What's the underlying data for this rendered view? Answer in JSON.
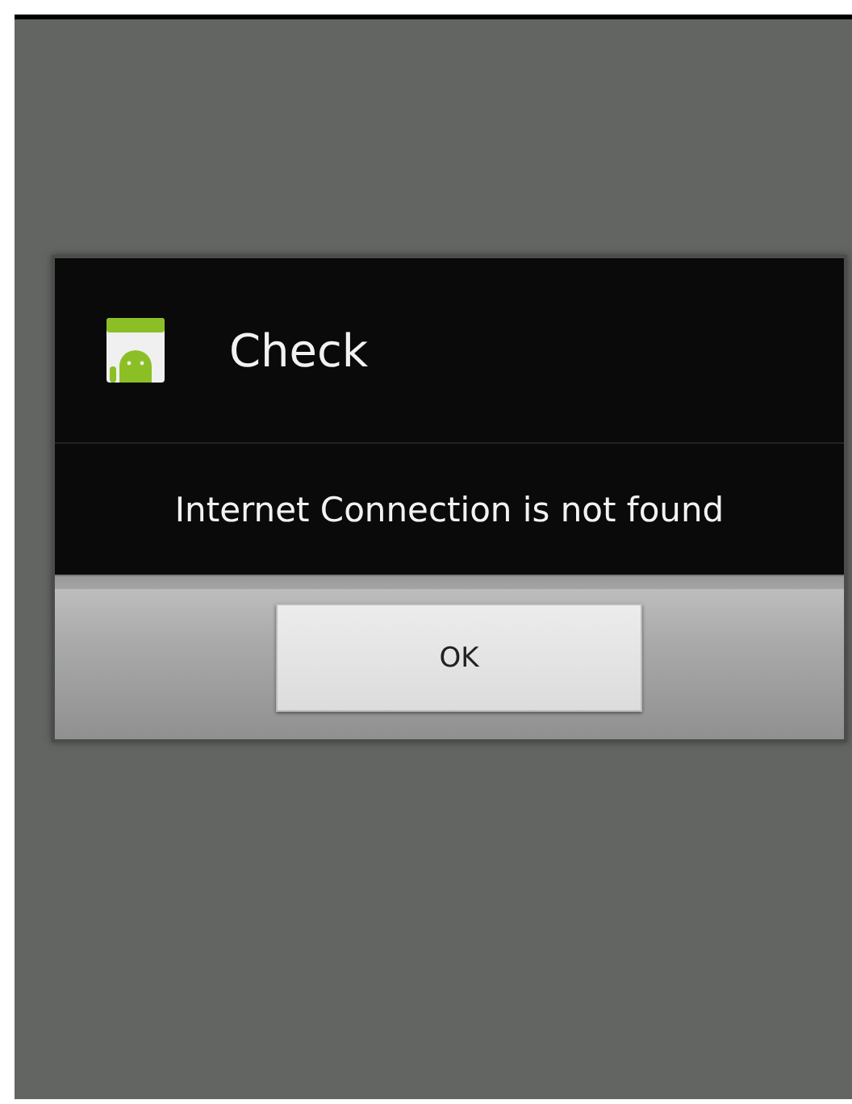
{
  "dialog": {
    "title": "Check",
    "message": "Internet Connection is not found",
    "buttons": [
      "OK"
    ]
  }
}
